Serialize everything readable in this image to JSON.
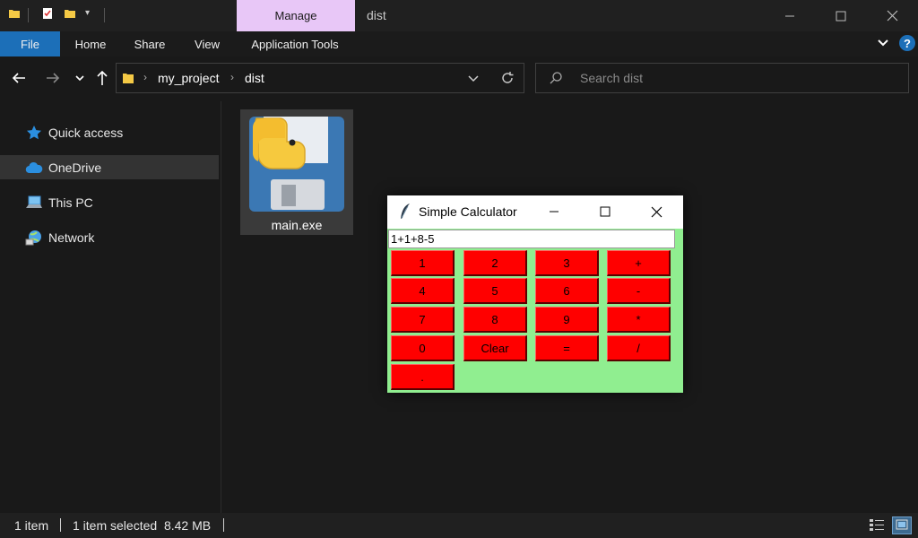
{
  "window": {
    "title": "dist",
    "manage_tab": "Manage"
  },
  "ribbon": {
    "tabs": [
      "File",
      "Home",
      "Share",
      "View",
      "Application Tools"
    ]
  },
  "address": {
    "crumbs": [
      "my_project",
      "dist"
    ],
    "search_placeholder": "Search dist"
  },
  "nav": {
    "items": [
      {
        "label": "Quick access",
        "icon": "star-icon"
      },
      {
        "label": "OneDrive",
        "icon": "cloud-icon"
      },
      {
        "label": "This PC",
        "icon": "computer-icon"
      },
      {
        "label": "Network",
        "icon": "network-icon"
      }
    ]
  },
  "files": [
    {
      "name": "main.exe",
      "icon": "python-exe-icon"
    }
  ],
  "status": {
    "count": "1 item",
    "selected": "1 item selected  8.42 MB"
  },
  "calculator": {
    "title": "Simple Calculator",
    "display": "1+1+8-5",
    "buttons": [
      "1",
      "2",
      "3",
      "+",
      "4",
      "5",
      "6",
      "-",
      "7",
      "8",
      "9",
      "*",
      "0",
      "Clear",
      "=",
      "/",
      "."
    ],
    "colors": {
      "background": "#90ee90",
      "button": "#ff0000"
    }
  },
  "colors": {
    "accent": "#1c6fb8",
    "manage_tab": "#e8c7f7"
  }
}
